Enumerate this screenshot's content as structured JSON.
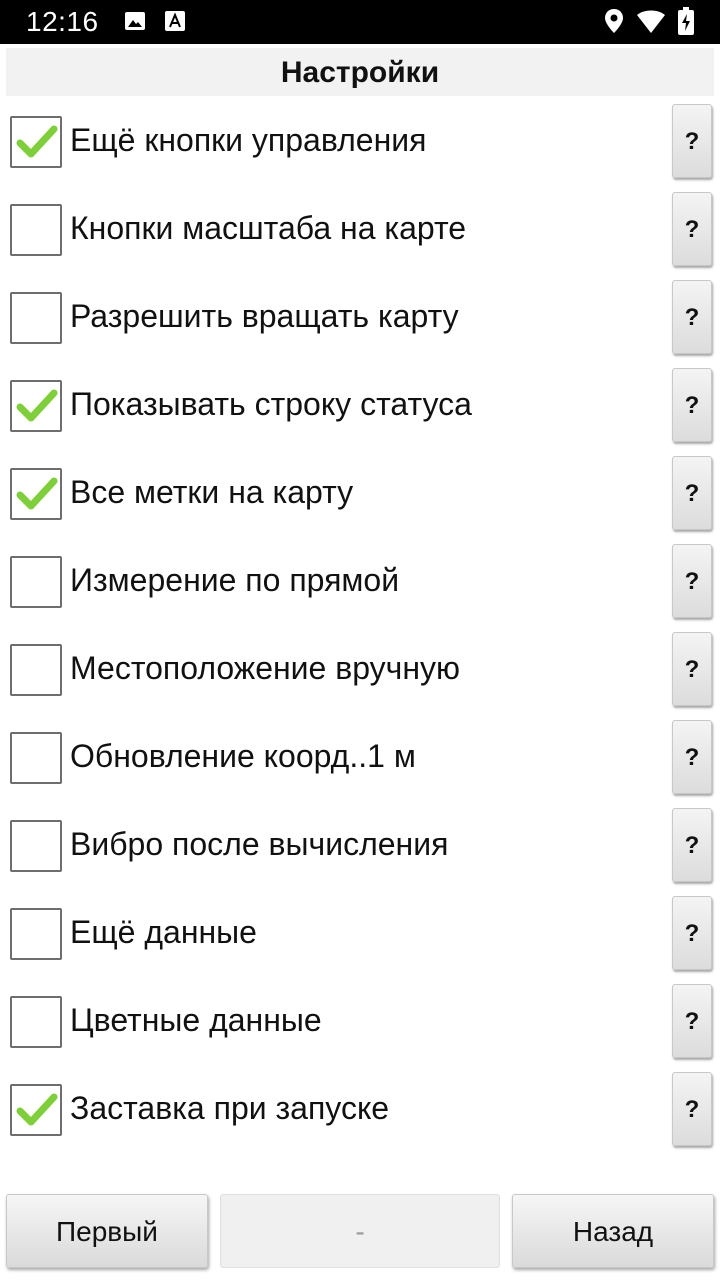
{
  "status_bar": {
    "time": "12:16",
    "icons": [
      "image-icon",
      "font-icon",
      "location-icon",
      "wifi-icon",
      "battery-icon"
    ]
  },
  "header": {
    "title": "Настройки"
  },
  "settings": [
    {
      "label": "Ещё кнопки управления",
      "checked": true,
      "help": "?"
    },
    {
      "label": "Кнопки масштаба на карте",
      "checked": false,
      "help": "?"
    },
    {
      "label": "Разрешить вращать карту",
      "checked": false,
      "help": "?"
    },
    {
      "label": "Показывать строку статуса",
      "checked": true,
      "help": "?"
    },
    {
      "label": "Все метки на карту",
      "checked": true,
      "help": "?"
    },
    {
      "label": "Измерение по прямой",
      "checked": false,
      "help": "?"
    },
    {
      "label": "Местоположение вручную",
      "checked": false,
      "help": "?"
    },
    {
      "label": "Обновление коорд..1 м",
      "checked": false,
      "help": "?"
    },
    {
      "label": "Вибро после вычисления",
      "checked": false,
      "help": "?"
    },
    {
      "label": "Ещё данные",
      "checked": false,
      "help": "?"
    },
    {
      "label": "Цветные данные",
      "checked": false,
      "help": "?"
    },
    {
      "label": "Заставка при запуске",
      "checked": true,
      "help": "?"
    }
  ],
  "bottom_bar": {
    "first_label": "Первый",
    "middle_label": "-",
    "back_label": "Назад"
  },
  "colors": {
    "check_green": "#7fcf3a",
    "status_bar_bg": "#000000",
    "header_bg": "#f2f2f2"
  }
}
